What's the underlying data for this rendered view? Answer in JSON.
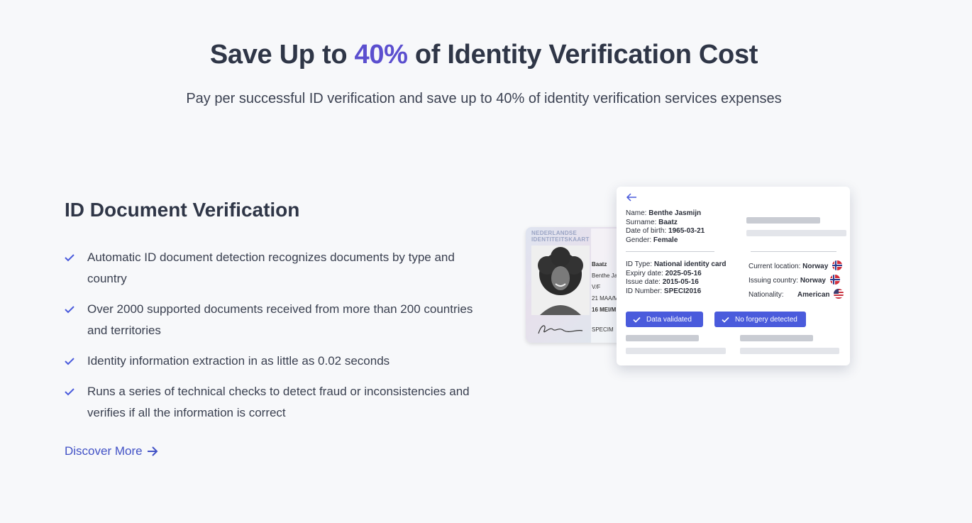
{
  "hero": {
    "title_before": "Save Up to ",
    "title_accent": "40%",
    "title_after": " of Identity Verification Cost",
    "subtitle": "Pay per successful ID verification and save up to 40% of identity verification services expenses"
  },
  "section": {
    "title": "ID Document Verification",
    "features": [
      "Automatic ID document detection recognizes documents by type and country",
      "Over 2000 supported documents received from more than 200 countries and territories",
      "Identity information extraction in as little as 0.02 seconds",
      "Runs a series of technical checks to detect fraud or inconsistencies and verifies if all the information is correct"
    ],
    "link_label": "Discover More"
  },
  "id_card": {
    "header_line1": "NEDERLANDSE",
    "header_line2": "IDENTITEITSKAART",
    "surname": "Baatz",
    "given": "Benthe Ja",
    "sex": "V/F",
    "dob": "21 MAA/M",
    "expiry": "16 MEI/M",
    "doc": "SPECIM"
  },
  "result": {
    "name_label": "Name:",
    "name_value": "Benthe Jasmijn",
    "surname_label": "Surname:",
    "surname_value": "Baatz",
    "dob_label": "Date of birth:",
    "dob_value": "1965-03-21",
    "gender_label": "Gender:",
    "gender_value": "Female",
    "idtype_label": "ID Type:",
    "idtype_value": "National identity card",
    "expiry_label": "Expiry date:",
    "expiry_value": "2025-05-16",
    "issue_label": "Issue date:",
    "issue_value": "2015-05-16",
    "idnum_label": "ID Number:",
    "idnum_value": "SPECI2016",
    "location_label": "Current location:",
    "location_value": "Norway",
    "issuing_label": "Issuing country:",
    "issuing_value": "Norway",
    "nationality_label": "Nationality:",
    "nationality_value": "American",
    "badge_validated": "Data validated",
    "badge_forgery": "No forgery detected"
  },
  "colors": {
    "accent": "#5b4fcf",
    "link": "#4252c6",
    "badge": "#4a5bdc",
    "check": "#4a5bdc"
  },
  "icons": [
    "check-icon",
    "arrow-right-icon",
    "back-arrow-icon",
    "norway-flag-icon",
    "usa-flag-icon"
  ]
}
